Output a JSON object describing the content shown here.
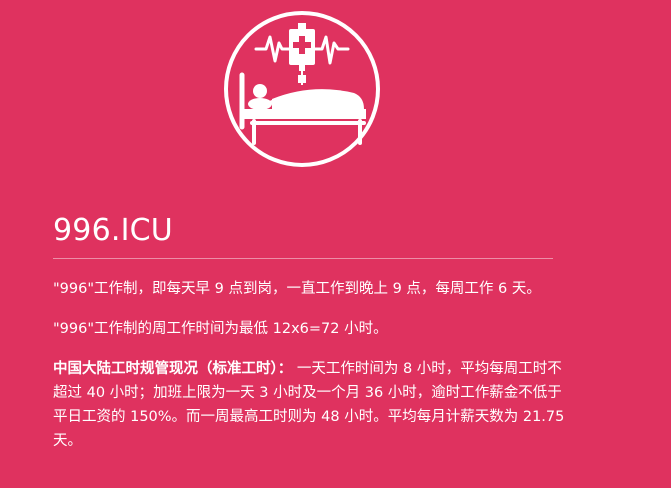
{
  "logo": {
    "name": "hospital-bed-icu-icon",
    "icon": "patient-in-hospital-bed-with-iv-drip-and-heartbeat"
  },
  "header": {
    "title": "996.ICU"
  },
  "main": {
    "paragraph_1": "\"996\"工作制，即每天早 9 点到岗，一直工作到晚上 9 点，每周工作 6 天。",
    "paragraph_2": "\"996\"工作制的周工作时间为最低 12x6=72 小时。",
    "paragraph_3_lead": "中国大陆工时规管现况（标准工时）：",
    "paragraph_3_body": " 一天工作时间为 8 小时，平均每周工时不超过 40 小时；加班上限为一天 3 小时及一个月 36 小时，逾时工作薪金不低于平日工资的 150%。而一周最高工时则为 48 小时。平均每月计薪天数为 21.75 天。"
  },
  "colors": {
    "background": "#df325f",
    "foreground": "#ffffff"
  }
}
